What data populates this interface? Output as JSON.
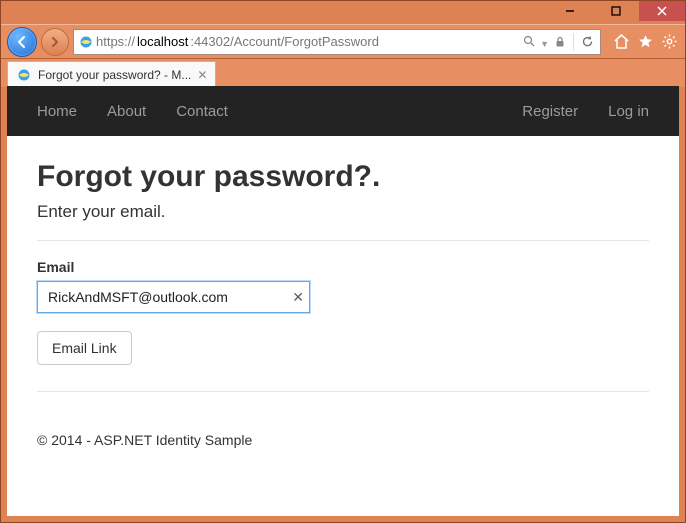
{
  "window": {
    "tab_title": "Forgot your password? - M...",
    "url_proto": "https://",
    "url_host": "localhost",
    "url_port_path": ":44302/Account/ForgotPassword"
  },
  "sitenav": {
    "home": "Home",
    "about": "About",
    "contact": "Contact",
    "register": "Register",
    "login": "Log in"
  },
  "page": {
    "heading": "Forgot your password?.",
    "lead": "Enter your email.",
    "email_label": "Email",
    "email_value": "RickAndMSFT@outlook.com",
    "submit_label": "Email Link",
    "footer": "© 2014 - ASP.NET Identity Sample"
  }
}
